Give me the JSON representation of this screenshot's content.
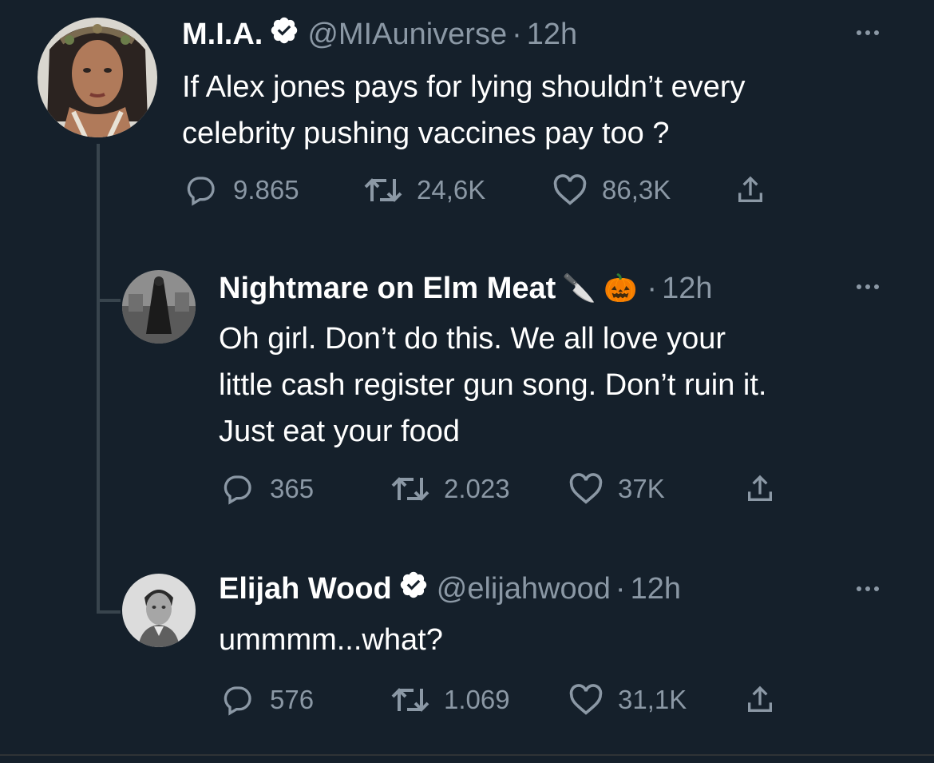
{
  "tweets": [
    {
      "display_name": "M.I.A.",
      "verified": true,
      "handle": "@MIAuniverse",
      "separator": "·",
      "time": "12h",
      "text_lines": [
        "If Alex jones pays for lying shouldn’t every",
        "celebrity pushing vaccines pay too ?"
      ],
      "stats": {
        "replies": "9.865",
        "retweets": "24,6K",
        "likes": "86,3K"
      }
    },
    {
      "display_name": "Nightmare on Elm Meat",
      "display_emoji": "🔪 🎃",
      "verified": false,
      "separator": "·",
      "time": "12h",
      "text_lines": [
        "Oh girl. Don’t do this. We all love your",
        "little cash register gun song. Don’t ruin it.",
        "Just eat your food"
      ],
      "stats": {
        "replies": "365",
        "retweets": "2.023",
        "likes": "37K"
      }
    },
    {
      "display_name": "Elijah Wood",
      "verified": true,
      "handle": "@elijahwood",
      "separator": "·",
      "time": "12h",
      "text_lines": [
        "ummmm...what?"
      ],
      "stats": {
        "replies": "576",
        "retweets": "1.069",
        "likes": "31,1K"
      }
    }
  ],
  "icons": {
    "reply": "reply-icon",
    "retweet": "retweet-icon",
    "like": "like-icon",
    "share": "share-icon",
    "more": "more-icon",
    "verified": "verified-badge-icon"
  },
  "colors": {
    "background": "#15202b",
    "text_primary": "#ffffff",
    "text_secondary": "#8b98a5",
    "thread_line": "#38444d"
  }
}
